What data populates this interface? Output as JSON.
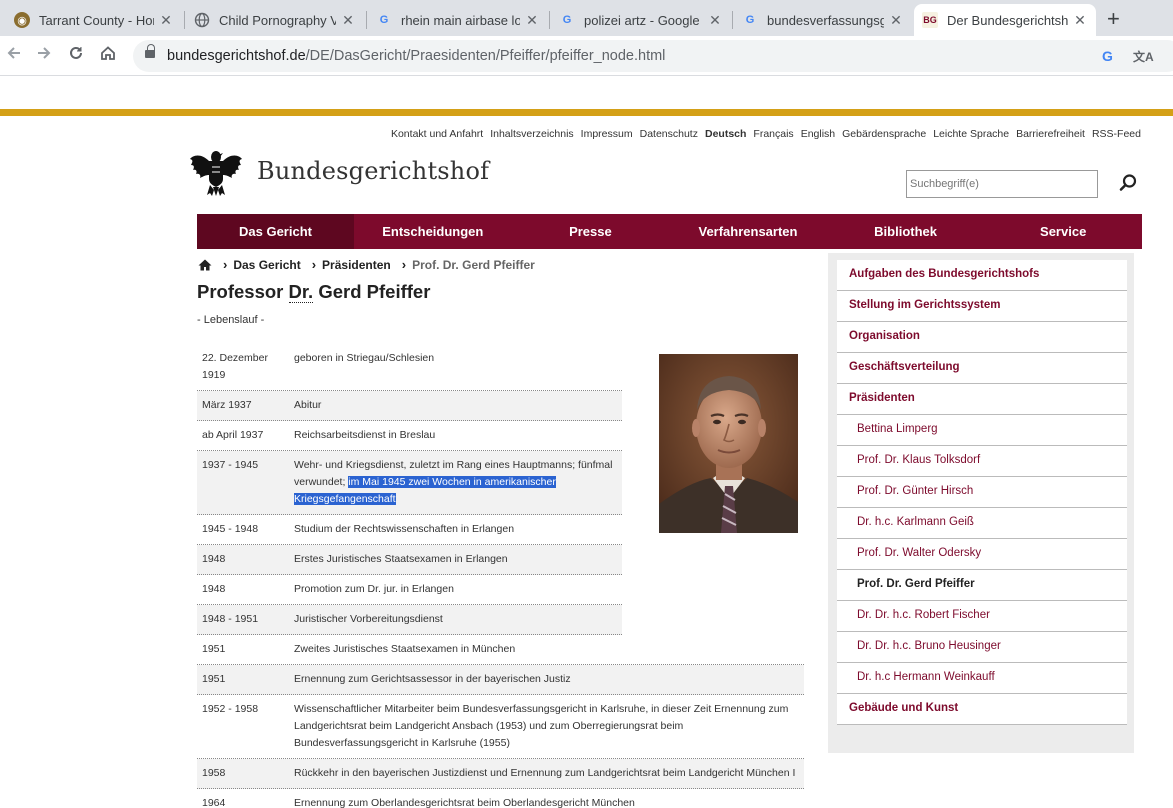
{
  "browser": {
    "tabs": [
      {
        "title": "Tarrant County - Home",
        "icon": "seal-icon"
      },
      {
        "title": "Child Pornography Vic",
        "icon": "globe-icon"
      },
      {
        "title": "rhein main airbase log",
        "icon": "google-icon"
      },
      {
        "title": "polizei artz - Google S",
        "icon": "google-icon"
      },
      {
        "title": "bundesverfassungsger",
        "icon": "google-icon"
      },
      {
        "title": "Der Bundesgerichtsho",
        "icon": "bgh-icon"
      }
    ],
    "url_host": "bundesgerichtshof.de",
    "url_path": "/DE/DasGericht/Praesidenten/Pfeiffer/pfeiffer_node.html"
  },
  "site": {
    "meta_nav": [
      "Kontakt und Anfahrt",
      "Inhaltsverzeichnis",
      "Impressum",
      "Datenschutz",
      "Deutsch",
      "Français",
      "English",
      "Gebärdensprache",
      "Leichte Sprache",
      "Barrierefreiheit",
      "RSS-Feed"
    ],
    "meta_nav_current": "Deutsch",
    "name": "Bundesgerichtshof",
    "search_placeholder": "Suchbegriff(e)",
    "main_nav": [
      "Das Gericht",
      "Entscheidungen",
      "Presse",
      "Verfahrensarten",
      "Bibliothek",
      "Service"
    ],
    "colors": {
      "brand": "#7d0a2c",
      "gold": "#d4a017"
    }
  },
  "breadcrumb": [
    "Das Gericht",
    "Präsidenten",
    "Prof. Dr. Gerd Pfeiffer"
  ],
  "page": {
    "title_pre": "Professor ",
    "title_abbr": "Dr.",
    "title_post": " Gerd Pfeiffer",
    "subtitle": "- Lebenslauf -"
  },
  "cv": [
    {
      "date": "22. Dezember 1919",
      "text": "geboren in Striegau/Schlesien"
    },
    {
      "date": "März 1937",
      "text": "Abitur"
    },
    {
      "date": "ab April 1937",
      "text": "Reichsarbeitsdienst in Breslau"
    },
    {
      "date": "1937 - 1945",
      "text": "Wehr- und Kriegsdienst, zuletzt im Rang eines Hauptmanns; fünfmal verwundet; ",
      "highlight": "im Mai 1945 zwei Wochen in amerikanischer Kriegsgefangenschaft"
    },
    {
      "date": "1945 - 1948",
      "text": "Studium der Rechtswissenschaften in Erlangen"
    },
    {
      "date": "1948",
      "text": "Erstes Juristisches Staatsexamen in Erlangen"
    },
    {
      "date": "1948",
      "text": "Promotion zum Dr. jur. in Erlangen"
    },
    {
      "date": "1948 - 1951",
      "text": "Juristischer Vorbereitungsdienst"
    },
    {
      "date": "1951",
      "text": "Zweites Juristisches Staatsexamen in München"
    },
    {
      "date": "1951",
      "text": "Ernennung zum Gerichtsassessor in der bayerischen Justiz"
    },
    {
      "date": "1952 - 1958",
      "text": "Wissenschaftlicher Mitarbeiter beim Bundesverfassungsgericht in Karlsruhe, in dieser Zeit Ernennung zum Landgerichtsrat beim Landgericht Ansbach (1953) und zum Oberregierungsrat beim Bundesverfassungsgericht in Karlsruhe (1955)"
    },
    {
      "date": "1958",
      "text": "Rückkehr in den bayerischen Justizdienst und Ernennung zum Landgerichtsrat beim Landgericht München I"
    },
    {
      "date": "1964",
      "text": "Ernennung zum Oberlandesgerichtsrat beim Oberlandesgericht München"
    }
  ],
  "sidebar": [
    {
      "label": "Aufgaben des Bundesgerichtshofs",
      "level": 1
    },
    {
      "label": "Stellung im Gerichtssystem",
      "level": 1
    },
    {
      "label": "Organisation",
      "level": 1
    },
    {
      "label": "Geschäftsverteilung",
      "level": 1
    },
    {
      "label": "Präsidenten",
      "level": 1
    },
    {
      "label": "Bettina Limperg",
      "level": 2
    },
    {
      "label": "Prof. Dr. Klaus Tolksdorf",
      "level": 2
    },
    {
      "label": "Prof. Dr. Günter Hirsch",
      "level": 2
    },
    {
      "label": "Dr. h.c. Karlmann Geiß",
      "level": 2
    },
    {
      "label": "Prof. Dr. Walter Odersky",
      "level": 2
    },
    {
      "label": "Prof. Dr. Gerd Pfeiffer",
      "level": 2,
      "current": true
    },
    {
      "label": "Dr. Dr. h.c. Robert Fischer",
      "level": 2
    },
    {
      "label": "Dr. Dr. h.c. Bruno Heusinger",
      "level": 2
    },
    {
      "label": "Dr. h.c Hermann Weinkauff",
      "level": 2
    },
    {
      "label": "Gebäude und Kunst",
      "level": 1
    }
  ]
}
